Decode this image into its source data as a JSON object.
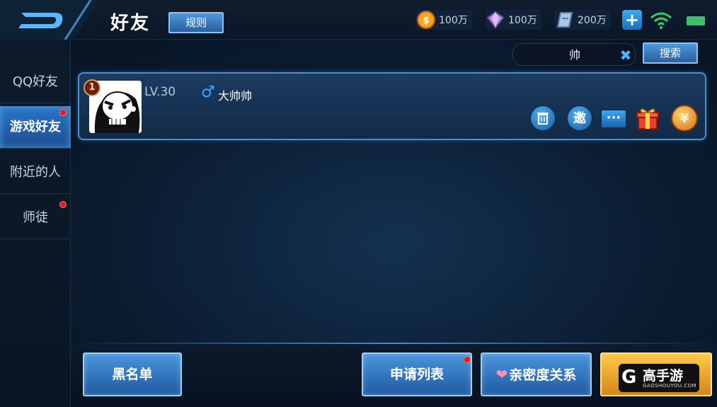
{
  "header": {
    "title": "好友",
    "rules_label": "规则",
    "resources": [
      {
        "icon": "gold-coin-icon",
        "value": "100万"
      },
      {
        "icon": "diamond-icon",
        "value": "100万"
      },
      {
        "icon": "voucher-icon",
        "value": "200万"
      }
    ]
  },
  "sidebar": {
    "items": [
      {
        "label": "QQ好友",
        "active": false,
        "dot": false
      },
      {
        "label": "游戏好友",
        "active": true,
        "dot": true
      },
      {
        "label": "附近的人",
        "active": false,
        "dot": false
      },
      {
        "label": "师徒",
        "active": false,
        "dot": true
      }
    ]
  },
  "search": {
    "value": "帅",
    "button_label": "搜索"
  },
  "friend": {
    "rank": "1",
    "level": "LV.30",
    "gender": "♂",
    "name": "大帅帅",
    "actions": [
      {
        "icon": "trash-icon",
        "glyph": "🗑"
      },
      {
        "icon": "invite-icon",
        "glyph": "邀"
      },
      {
        "icon": "chat-icon",
        "glyph": "···"
      },
      {
        "icon": "gift-icon",
        "glyph": "🎁"
      },
      {
        "icon": "coin-send-icon",
        "glyph": "¥"
      }
    ]
  },
  "bottom": {
    "blacklist_label": "黑名单",
    "requests_label": "申请列表",
    "intimacy_label": "亲密度关系",
    "logo_text": "高手游",
    "logo_sub": "GAOSHOUYOU.COM"
  },
  "colors": {
    "accent": "#3b8de0",
    "badge_red": "#e41c1c",
    "gold": "#ffc94a"
  }
}
